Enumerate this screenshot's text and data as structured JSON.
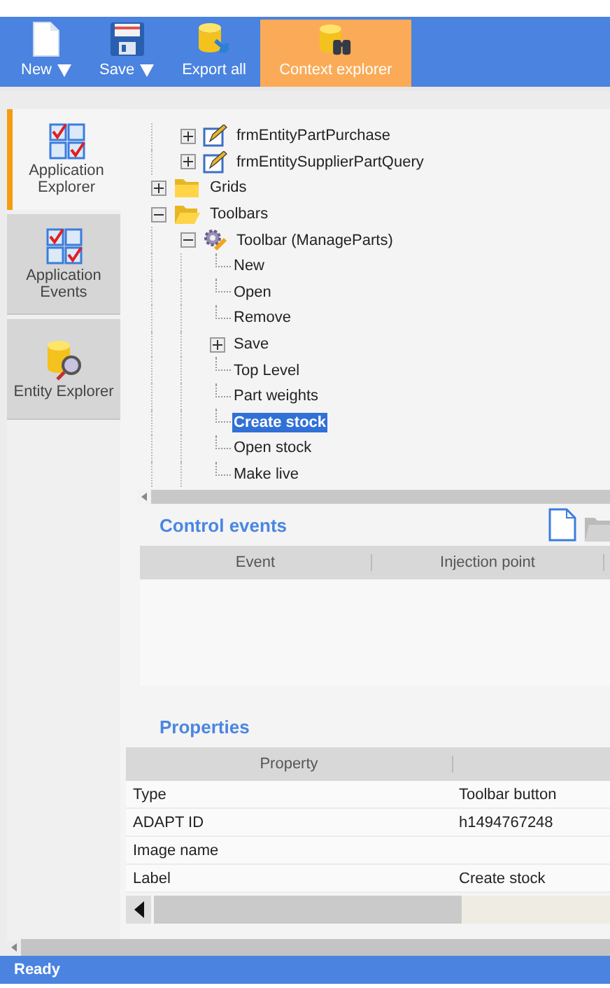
{
  "toolbar": {
    "buttons": [
      {
        "label": "New",
        "kind": "new",
        "dropdown": true,
        "selected": false
      },
      {
        "label": "Save",
        "kind": "save",
        "dropdown": true,
        "selected": false
      },
      {
        "label": "Export all",
        "kind": "export",
        "dropdown": false,
        "selected": false
      },
      {
        "label": "Context explorer",
        "kind": "context",
        "dropdown": false,
        "selected": true
      }
    ]
  },
  "sidebar": {
    "items": [
      {
        "label": "Application Explorer",
        "kind": "app",
        "selected": true
      },
      {
        "label": "Application Events",
        "kind": "app",
        "selected": false
      },
      {
        "label": "Entity Explorer",
        "kind": "entity",
        "selected": false
      }
    ]
  },
  "tree": {
    "items": [
      {
        "kind": "continued",
        "children": [
          {
            "label": "frmEntityPartPurchase",
            "kind": "form",
            "expanded": false,
            "selected": false
          },
          {
            "label": "frmEntitySupplierPartQuery",
            "kind": "form",
            "expanded": false,
            "selected": false
          }
        ]
      },
      {
        "label": "Grids",
        "kind": "folder",
        "expanded": false,
        "selected": false
      },
      {
        "label": "Toolbars",
        "kind": "folder",
        "expanded": true,
        "selected": false,
        "children": [
          {
            "label": "Toolbar (ManageParts)",
            "kind": "toolbar",
            "expanded": true,
            "selected": false,
            "children": [
              {
                "label": "New",
                "kind": "button",
                "selected": false
              },
              {
                "label": "Open",
                "kind": "button",
                "selected": false
              },
              {
                "label": "Remove",
                "kind": "button",
                "selected": false
              },
              {
                "label": "Save",
                "kind": "button",
                "expanded": false,
                "selected": false
              },
              {
                "label": "Top Level",
                "kind": "button",
                "selected": false
              },
              {
                "label": "Part weights",
                "kind": "button",
                "selected": false
              },
              {
                "label": "Create stock",
                "kind": "button",
                "selected": true
              },
              {
                "label": "Open stock",
                "kind": "button",
                "selected": false
              },
              {
                "label": "Make live",
                "kind": "button",
                "selected": false
              }
            ]
          }
        ]
      }
    ]
  },
  "control_events": {
    "title": "Control events",
    "columns": [
      "Event",
      "Injection point"
    ]
  },
  "properties": {
    "title": "Properties",
    "columns": [
      "Property"
    ],
    "rows": [
      {
        "property": "Type",
        "value": "Toolbar button"
      },
      {
        "property": "ADAPT ID",
        "value": "h1494767248"
      },
      {
        "property": "Image name"
      },
      {
        "property": "Label",
        "value": "Create stock"
      }
    ]
  },
  "status_bar": {
    "text": "Ready"
  }
}
